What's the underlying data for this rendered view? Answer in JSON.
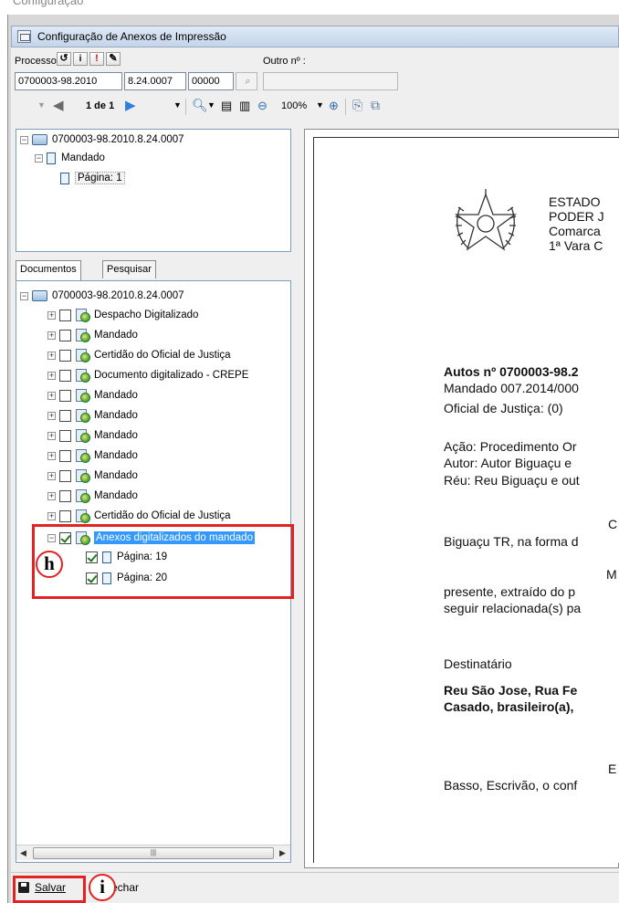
{
  "window": {
    "title": "Configuração de Anexos de Impressão",
    "top_partial_text": "Configuração"
  },
  "process_bar": {
    "process_label": "Processo:",
    "other_label": "Outro nº :",
    "fields": [
      "0700003-98.2010",
      "8.24.0007",
      "00000"
    ],
    "other_value": ""
  },
  "navigation": {
    "page_indicator": "1 de 1",
    "zoom": "100%"
  },
  "top_tree": {
    "root": "0700003-98.2010.8.24.0007",
    "child": "Mandado",
    "leaf": "Página: 1"
  },
  "tabs": [
    {
      "label": "Documentos",
      "active": true
    },
    {
      "label": "Pesquisar",
      "active": false
    }
  ],
  "documents_tree": {
    "root": "0700003-98.2010.8.24.0007",
    "items": [
      {
        "label": "Despacho Digitalizado",
        "checked": false
      },
      {
        "label": "Mandado",
        "checked": false
      },
      {
        "label": "Certidão do Oficial de Justiça",
        "checked": false
      },
      {
        "label": "Documento digitalizado - CREPE",
        "checked": false
      },
      {
        "label": "Mandado",
        "checked": false
      },
      {
        "label": "Mandado",
        "checked": false
      },
      {
        "label": "Mandado",
        "checked": false
      },
      {
        "label": "Mandado",
        "checked": false
      },
      {
        "label": "Mandado",
        "checked": false
      },
      {
        "label": "Mandado",
        "checked": false
      },
      {
        "label": "Certidão do Oficial de Justiça",
        "checked": false
      }
    ],
    "selected_item": {
      "label": "Anexos digitalizados do mandado",
      "checked": true
    },
    "subpages": [
      {
        "label": "Página: 19",
        "checked": true
      },
      {
        "label": "Página: 20",
        "checked": true
      }
    ]
  },
  "callouts": {
    "h": "h",
    "i": "i"
  },
  "preview": {
    "header_lines": [
      "ESTADO",
      "PODER J",
      "Comarca",
      "1ª Vara C"
    ],
    "autos": "Autos nº 0700003-98.2",
    "mandado": "Mandado 007.2014/000",
    "oficial": "Oficial de Justiça:  (0)",
    "acao": "Ação: Procedimento Or",
    "autor": "Autor: Autor Biguaçu e",
    "reu": "Réu: Reu Biguaçu e out",
    "c_letter": "C",
    "biguacu_line": "Biguaçu TR, na forma d",
    "m_letter": "M",
    "presente_line": "presente, extraído do p",
    "seguir_line": "seguir relacionada(s) pa",
    "destinatario": "Destinatário",
    "reu_sao_jose": "Reu São Jose, Rua Fe",
    "casado": "Casado, brasileiro(a),",
    "e_letter": "E",
    "basso_line": "Basso, Escrivão, o conf"
  },
  "footer": {
    "save_label": "Salvar",
    "close_label": "echar"
  }
}
